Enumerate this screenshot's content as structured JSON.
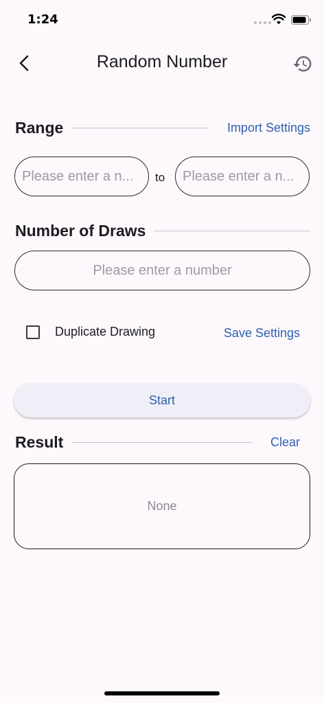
{
  "status_bar": {
    "time": "1:24"
  },
  "app_bar": {
    "title": "Random Number",
    "back_icon": "chevron-left-icon",
    "history_icon": "history-icon"
  },
  "range": {
    "title": "Range",
    "import_label": "Import Settings",
    "min_placeholder": "Please enter a n...",
    "max_placeholder": "Please enter a n...",
    "to_label": "to"
  },
  "draws": {
    "title": "Number of Draws",
    "placeholder": "Please enter a number"
  },
  "options": {
    "duplicate_label": "Duplicate Drawing",
    "duplicate_checked": false,
    "save_label": "Save Settings"
  },
  "actions": {
    "start_label": "Start"
  },
  "result": {
    "title": "Result",
    "clear_label": "Clear",
    "value": "None"
  },
  "colors": {
    "background": "#fcf8fc",
    "accent": "#2f5fae",
    "text": "#1d1b20",
    "placeholder": "#9e9aa2"
  }
}
